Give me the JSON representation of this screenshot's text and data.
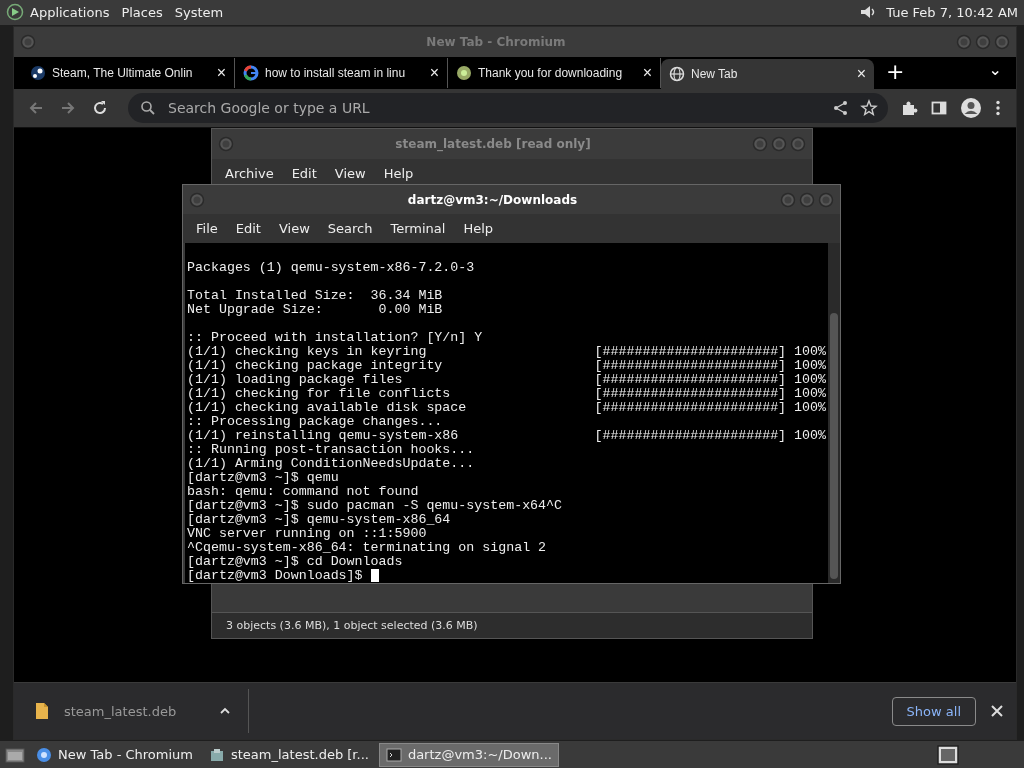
{
  "top_panel": {
    "menus": [
      "Applications",
      "Places",
      "System"
    ],
    "clock": "Tue Feb  7, 10:42 AM"
  },
  "browser": {
    "title": "New Tab - Chromium",
    "tabs": [
      {
        "label": "Steam, The Ultimate Onlin",
        "selected": false
      },
      {
        "label": "how to install steam in linu",
        "selected": false
      },
      {
        "label": "Thank you for downloading",
        "selected": false
      },
      {
        "label": "New Tab",
        "selected": true
      }
    ],
    "new_tab": "+",
    "close": "×",
    "dropdown": "⌄",
    "omnibox": {
      "placeholder": "Search Google or type a URL"
    },
    "download": {
      "file": "steam_latest.deb",
      "show_all": "Show all"
    }
  },
  "archive_window": {
    "title": "steam_latest.deb [read only]",
    "menus": [
      "Archive",
      "Edit",
      "View",
      "Help"
    ],
    "status": "3 objects (3.6 MB), 1 object selected (3.6 MB)"
  },
  "terminal_window": {
    "title": "dartz@vm3:~/Downloads",
    "menus": [
      "File",
      "Edit",
      "View",
      "Search",
      "Terminal",
      "Help"
    ],
    "lines": [
      {
        "kind": "blank"
      },
      {
        "kind": "text",
        "text": "Packages (1) qemu-system-x86-7.2.0-3"
      },
      {
        "kind": "blank"
      },
      {
        "kind": "text",
        "text": "Total Installed Size:  36.34 MiB"
      },
      {
        "kind": "text",
        "text": "Net Upgrade Size:       0.00 MiB"
      },
      {
        "kind": "blank"
      },
      {
        "kind": "text",
        "text": ":: Proceed with installation? [Y/n] Y"
      },
      {
        "kind": "progress",
        "text": "(1/1) checking keys in keyring",
        "bar": "[######################] 100%"
      },
      {
        "kind": "progress",
        "text": "(1/1) checking package integrity",
        "bar": "[######################] 100%"
      },
      {
        "kind": "progress",
        "text": "(1/1) loading package files",
        "bar": "[######################] 100%"
      },
      {
        "kind": "progress",
        "text": "(1/1) checking for file conflicts",
        "bar": "[######################] 100%"
      },
      {
        "kind": "progress",
        "text": "(1/1) checking available disk space",
        "bar": "[######################] 100%"
      },
      {
        "kind": "text",
        "text": ":: Processing package changes..."
      },
      {
        "kind": "progress",
        "text": "(1/1) reinstalling qemu-system-x86",
        "bar": "[######################] 100%"
      },
      {
        "kind": "text",
        "text": ":: Running post-transaction hooks..."
      },
      {
        "kind": "text",
        "text": "(1/1) Arming ConditionNeedsUpdate..."
      },
      {
        "kind": "text",
        "text": "[dartz@vm3 ~]$ qemu"
      },
      {
        "kind": "text",
        "text": "bash: qemu: command not found"
      },
      {
        "kind": "text",
        "text": "[dartz@vm3 ~]$ sudo pacman -S qemu-system-x64^C"
      },
      {
        "kind": "text",
        "text": "[dartz@vm3 ~]$ qemu-system-x86_64"
      },
      {
        "kind": "text",
        "text": "VNC server running on ::1:5900"
      },
      {
        "kind": "text",
        "text": "^Cqemu-system-x86_64: terminating on signal 2"
      },
      {
        "kind": "text",
        "text": "[dartz@vm3 ~]$ cd Downloads"
      },
      {
        "kind": "prompt",
        "text": "[dartz@vm3 Downloads]$"
      }
    ]
  },
  "taskbar": {
    "items": [
      {
        "label": "New Tab - Chromium",
        "selected": false
      },
      {
        "label": "steam_latest.deb [r...",
        "selected": false
      },
      {
        "label": "dartz@vm3:~/Down...",
        "selected": true
      }
    ]
  }
}
